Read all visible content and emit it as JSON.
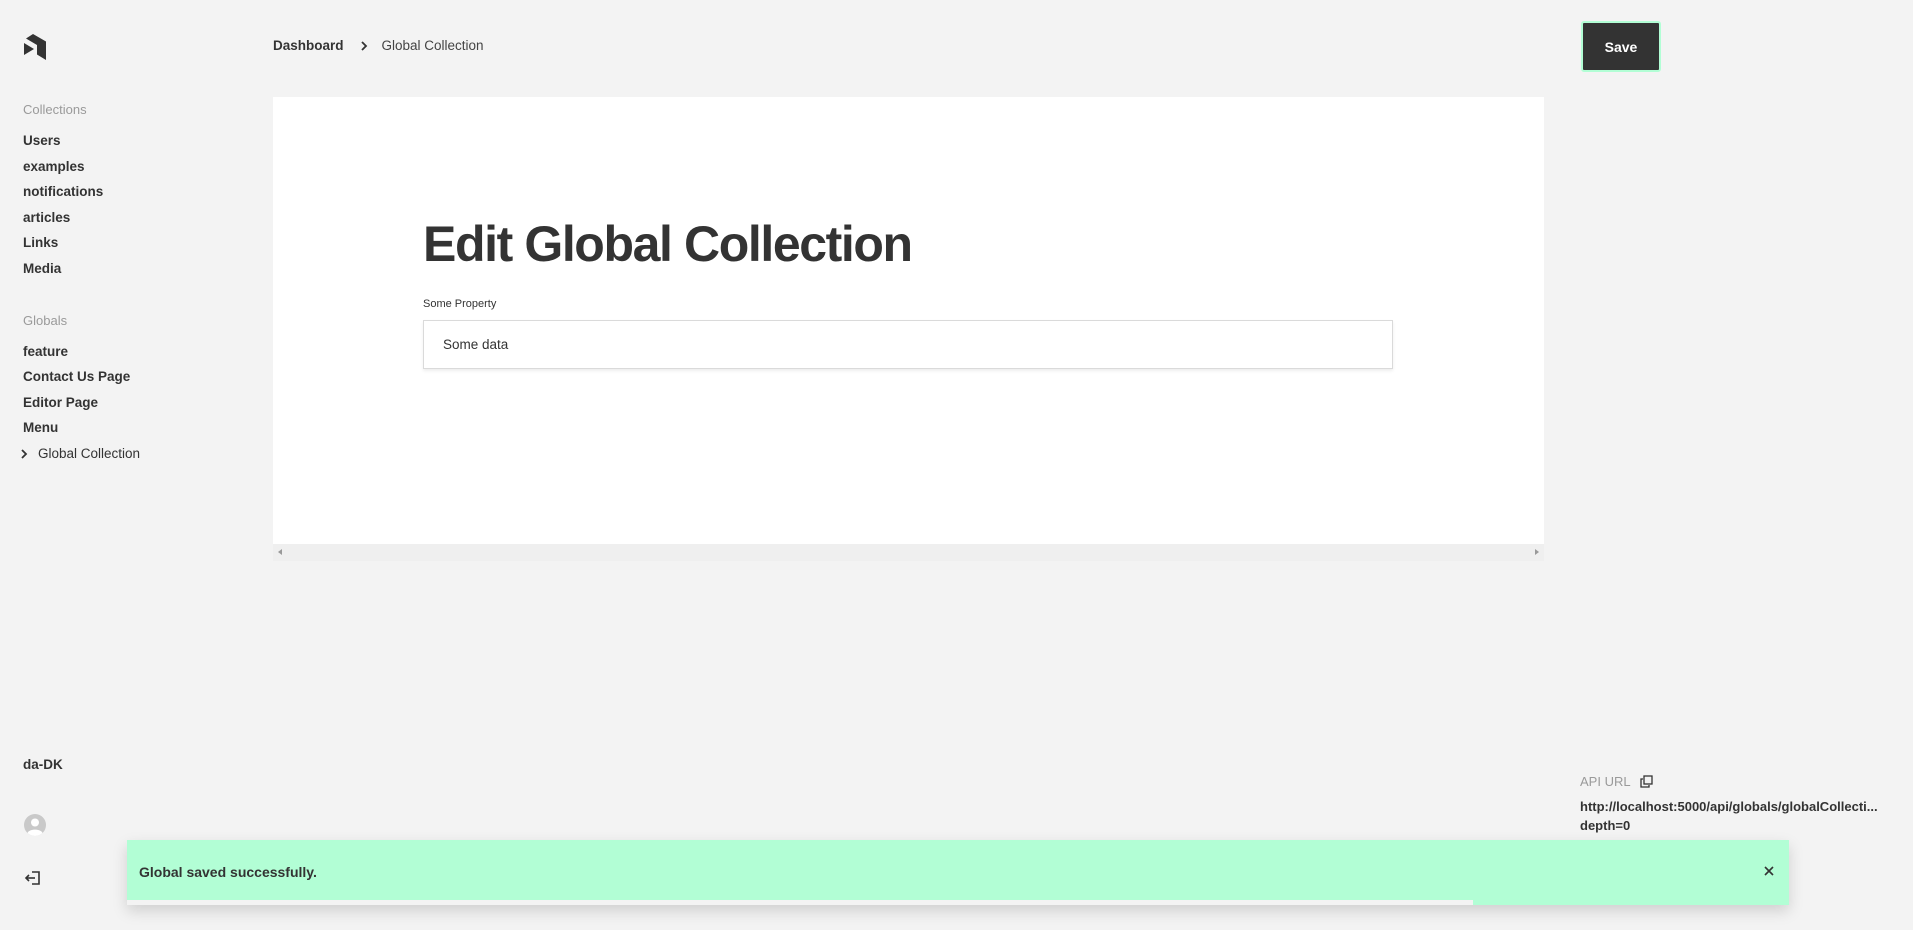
{
  "sidebar": {
    "collections_label": "Collections",
    "collections": [
      "Users",
      "examples",
      "notifications",
      "articles",
      "Links",
      "Media"
    ],
    "globals_label": "Globals",
    "globals": [
      "feature",
      "Contact Us Page",
      "Editor Page",
      "Menu",
      "Global Collection"
    ],
    "active_global": "Global Collection",
    "locale": "da-DK"
  },
  "header": {
    "breadcrumb_home": "Dashboard",
    "breadcrumb_current": "Global Collection",
    "save_label": "Save"
  },
  "main": {
    "title": "Edit Global Collection",
    "field_label": "Some Property",
    "field_value": "Some data"
  },
  "api": {
    "label": "API URL",
    "url_line1": "http://localhost:5000/api/globals/globalCollecti...",
    "url_line2": "depth=0"
  },
  "toast": {
    "message": "Global saved successfully.",
    "progress_remaining": 0.19
  },
  "colors": {
    "background": "#f3f3f3",
    "accent": "#b2fed5",
    "text": "#333333",
    "muted": "#9a9a9a",
    "card": "#ffffff"
  }
}
